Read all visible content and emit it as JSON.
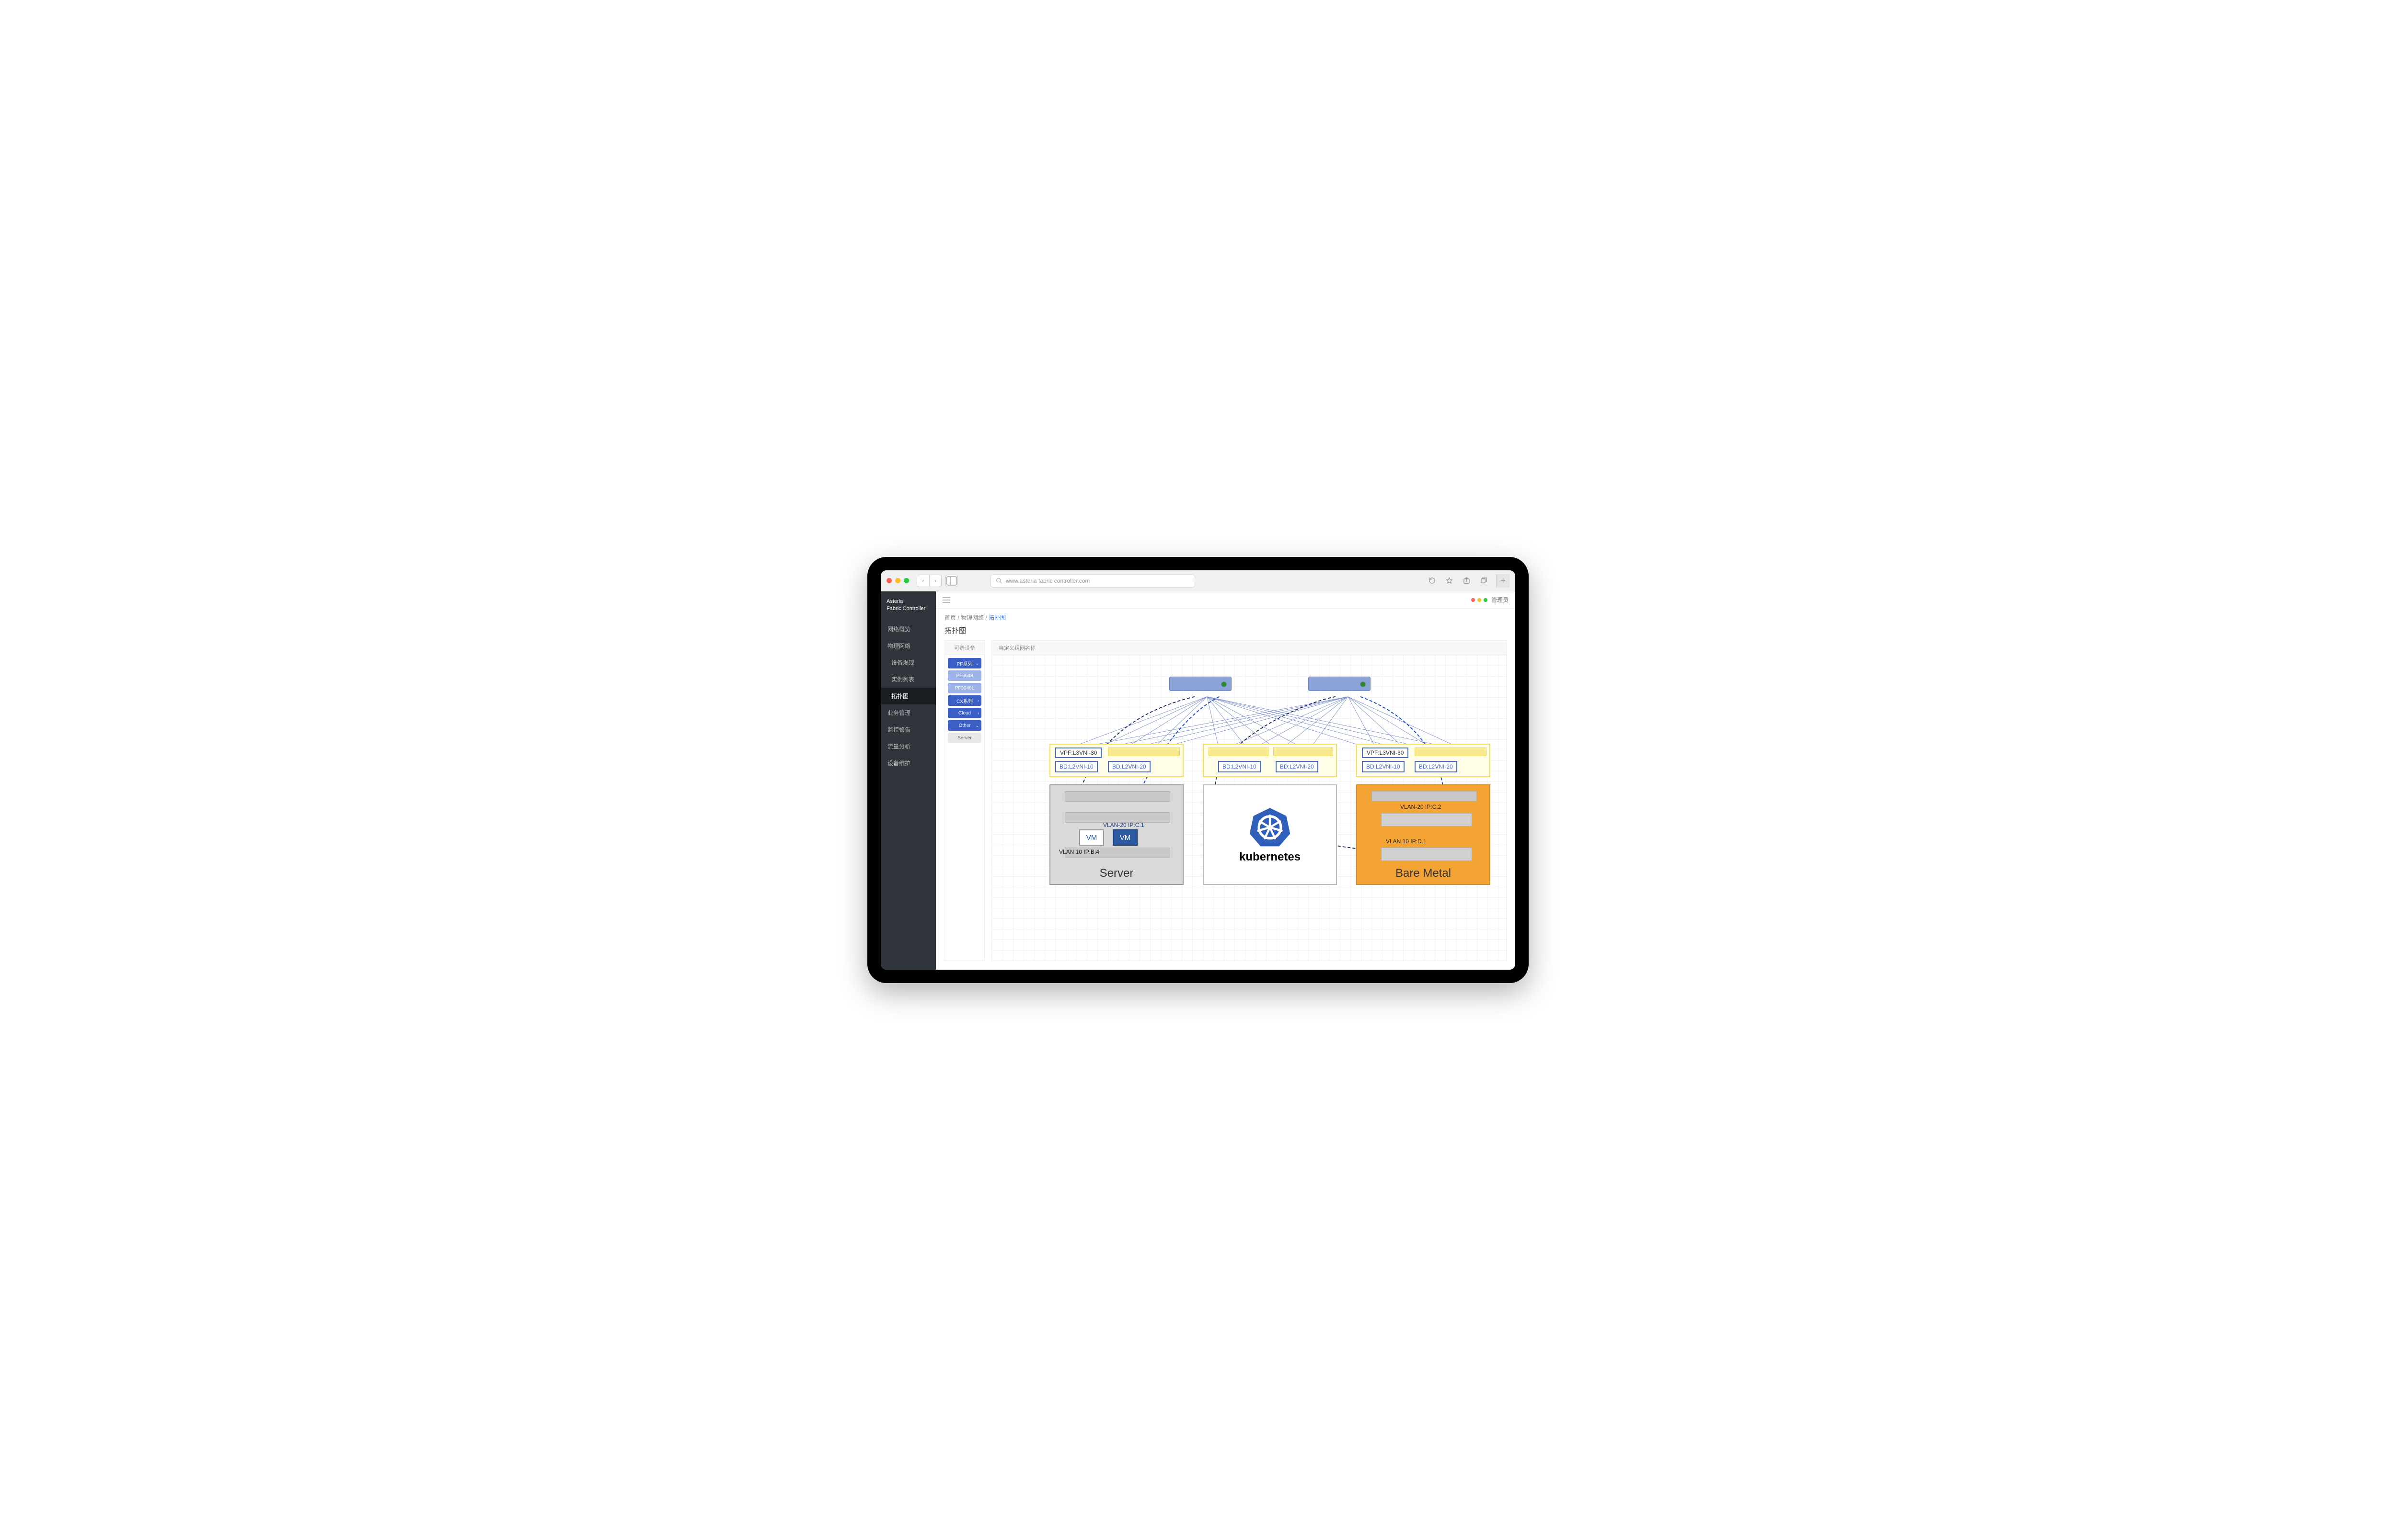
{
  "browser": {
    "url": "www.asteria fabric controller.com",
    "plus": "+"
  },
  "sidebar": {
    "logo_line1": "Asteria",
    "logo_line2": "Fabric Controller",
    "items": [
      {
        "label": "网络概览",
        "sub": false,
        "active": false
      },
      {
        "label": "物理网络",
        "sub": false,
        "active": false
      },
      {
        "label": "设备发现",
        "sub": true,
        "active": false
      },
      {
        "label": "实例列表",
        "sub": true,
        "active": false
      },
      {
        "label": "拓扑图",
        "sub": true,
        "active": true
      },
      {
        "label": "业务管理",
        "sub": false,
        "active": false
      },
      {
        "label": "监控警告",
        "sub": false,
        "active": false
      },
      {
        "label": "流量分析",
        "sub": false,
        "active": false
      },
      {
        "label": "设备维护",
        "sub": false,
        "active": false
      }
    ]
  },
  "topbar": {
    "user_label": "管理员"
  },
  "breadcrumb": {
    "a": "首页",
    "b": "物理网络",
    "c": "拓扑图",
    "sep": " / "
  },
  "page_title": "拓扑图",
  "palette": {
    "header": "可选设备",
    "items": [
      {
        "label": "PF系列",
        "style": "blue",
        "chev": "⌄"
      },
      {
        "label": "PF6648",
        "style": "lblue",
        "chev": ""
      },
      {
        "label": "PF3048L",
        "style": "lblue",
        "chev": ""
      },
      {
        "label": "CX系列",
        "style": "blue",
        "chev": "›"
      },
      {
        "label": "Cloud",
        "style": "blue",
        "chev": "›"
      },
      {
        "label": "Other",
        "style": "blue",
        "chev": "⌄"
      },
      {
        "label": "Server",
        "style": "gray",
        "chev": ""
      }
    ]
  },
  "canvas": {
    "tab": "自定义组网名称",
    "zone1": {
      "vpf": "VPF:L3VNI-30",
      "bd1": "BD:L2VNI-10",
      "bd2": "BD:L2VNI-20"
    },
    "zone2": {
      "bd1": "BD:L2VNI-10",
      "bd2": "BD:L2VNI-20"
    },
    "zone3": {
      "vpf": "VPF:L3VNI-30",
      "bd1": "BD:L2VNI-10",
      "bd2": "BD:L2VNI-20"
    },
    "server": {
      "title": "Server",
      "vm": "VM",
      "vm2": "VM",
      "vm_label": "VLAN 10 IP:B.4",
      "vm2_label": "VLAN-20 IP:C.1"
    },
    "k8s": {
      "title": "kubernetes"
    },
    "bare": {
      "title": "Bare Metal",
      "nic1": "VLAN-20 IP:C.2",
      "nic2": "VLAN 10 IP:D.1"
    }
  },
  "colors": {
    "accent": "#3b5fc4"
  }
}
